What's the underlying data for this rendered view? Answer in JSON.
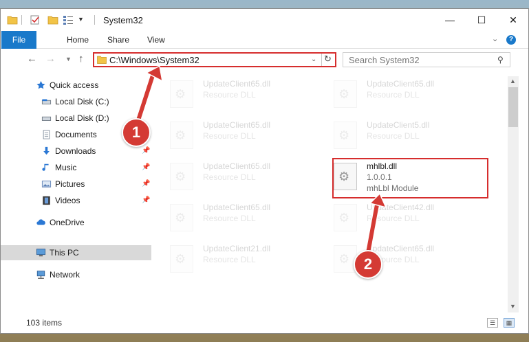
{
  "window": {
    "title": "System32",
    "controls": {
      "minimize": "—",
      "maximize": "☐",
      "close": "✕"
    }
  },
  "ribbon": {
    "tabs": [
      "File",
      "Home",
      "Share",
      "View"
    ],
    "help": "?"
  },
  "navigation": {
    "address": "C:\\Windows\\System32",
    "search_placeholder": "Search System32"
  },
  "sidebar": {
    "items": [
      {
        "label": "Quick access",
        "icon": "star-icon",
        "pinned": false
      },
      {
        "label": "Local Disk (C:)",
        "icon": "drive-icon",
        "pinned": false
      },
      {
        "label": "Local Disk (D:)",
        "icon": "drive-icon",
        "pinned": false
      },
      {
        "label": "Documents",
        "icon": "documents-icon",
        "pinned": true
      },
      {
        "label": "Downloads",
        "icon": "download-arrow-icon",
        "pinned": true
      },
      {
        "label": "Music",
        "icon": "music-note-icon",
        "pinned": true
      },
      {
        "label": "Pictures",
        "icon": "pictures-icon",
        "pinned": true
      },
      {
        "label": "Videos",
        "icon": "film-icon",
        "pinned": true
      },
      {
        "label": "OneDrive",
        "icon": "cloud-icon",
        "pinned": false
      },
      {
        "label": "This PC",
        "icon": "computer-icon",
        "pinned": false,
        "selected": true
      },
      {
        "label": "Network",
        "icon": "network-icon",
        "pinned": false
      }
    ]
  },
  "files": [
    {
      "name": "UpdateClient65.dll",
      "type": "Resource DLL",
      "faded": true
    },
    {
      "name": "UpdateClient65.dll",
      "type": "Resource DLL",
      "faded": true
    },
    {
      "name": "UpdateClient65.dll",
      "type": "Resource DLL",
      "faded": true
    },
    {
      "name": "UpdateClient5.dll",
      "type": "Resource DLL",
      "faded": true
    },
    {
      "name": "UpdateClient65.dll",
      "type": "Resource DLL",
      "faded": true
    },
    {
      "name": "mhlbl.dll",
      "version": "1.0.0.1",
      "type": "mhLbl Module",
      "faded": false,
      "highlighted": true
    },
    {
      "name": "UpdateClient65.dll",
      "type": "Resource DLL",
      "faded": true
    },
    {
      "name": "UpdateClient42.dll",
      "type": "Resource DLL",
      "faded": true
    },
    {
      "name": "UpdateClient21.dll",
      "type": "Resource DLL",
      "faded": true
    },
    {
      "name": "UpdateClient65.dll",
      "type": "Resource DLL",
      "faded": true
    }
  ],
  "status": {
    "item_count": "103 items"
  },
  "annotations": {
    "step1": "1",
    "step2": "2",
    "color": "#d43a34"
  },
  "colors": {
    "accent": "#1979ca",
    "highlight_border": "#d62d2d",
    "selection": "#d9d9d9"
  }
}
